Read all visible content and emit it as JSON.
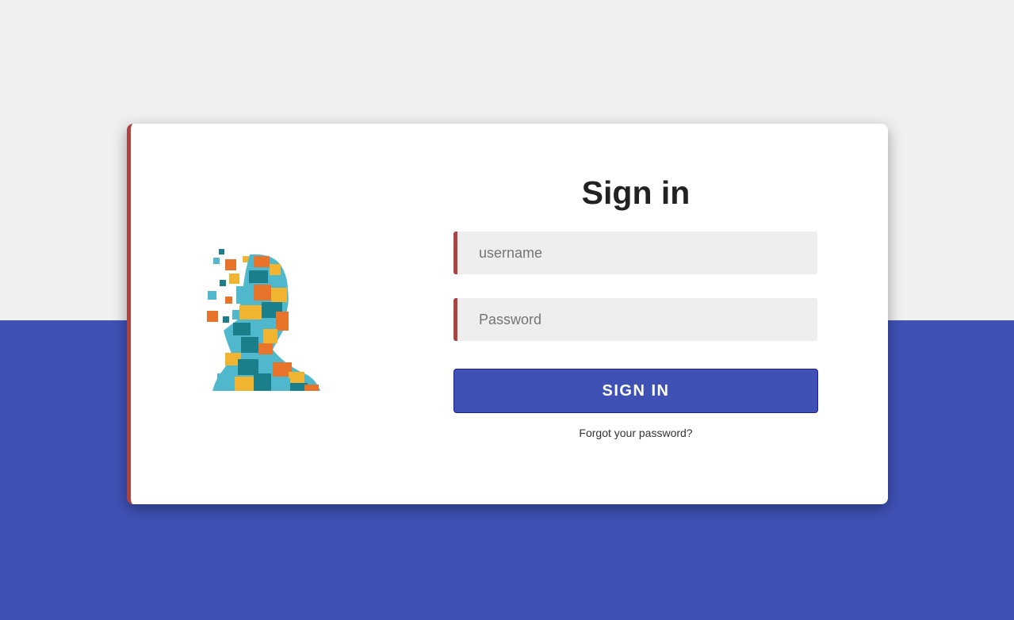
{
  "login": {
    "title": "Sign in",
    "username_placeholder": "username",
    "password_placeholder": "Password",
    "submit_label": "SIGN IN",
    "forgot_link": "Forgot your password?"
  },
  "colors": {
    "accent": "#3f51b5",
    "border_accent": "#a94442",
    "background_top": "#f0f0f0",
    "field_bg": "#eeeeee"
  },
  "logo": {
    "icon": "pixel-head-logo"
  }
}
